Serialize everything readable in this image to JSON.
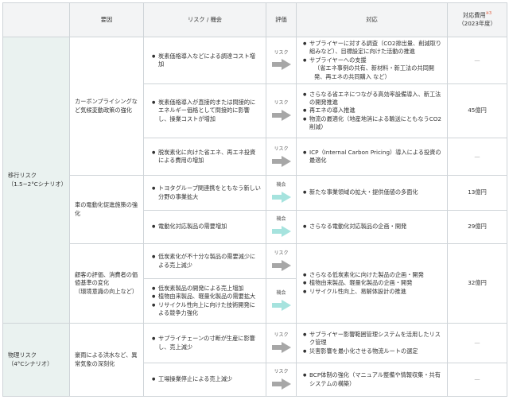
{
  "headers": {
    "factor": "要因",
    "risk": "リスク / 機会",
    "eval": "評価",
    "response": "対応",
    "cost_line1": "対応費用",
    "cost_note": "※3",
    "cost_line2": "（2023年度）"
  },
  "categories": {
    "transition": {
      "line1": "移行リスク",
      "line2": "（1.5~2°Cシナリオ）"
    },
    "physical": {
      "line1": "物理リスク",
      "line2": "（4°Cシナリオ）"
    }
  },
  "factors": {
    "carbon": "カーボンプライシングなど気候変動政策の強化",
    "ev": "車の電動化促進施策の強化",
    "customer_line1": "顧客の評価、消費者の価値基準の変化",
    "customer_line2": "（環境意識の向上など）",
    "weather": "豪雨による洪水など、異常気象の深刻化"
  },
  "eval_labels": {
    "risk": "リスク",
    "opportunity": "機会"
  },
  "colors": {
    "risk_arrow": "#a7a7a7",
    "opportunity_arrow": "#a6e3de",
    "category_bg": "#eaf2f0",
    "header_bg": "#f3f4f5"
  },
  "rows": [
    {
      "risk": [
        "炭素価格導入などによる調達コスト増加"
      ],
      "response": [
        "サプライヤーに対する調査（CO2排出量、削減取り組みなど）、目標設定に向けた活動の推進",
        "サプライヤーへの支援",
        "（省エネ事例の共有、新材料・新工法の共同開発、再エネの共同購入 など）"
      ],
      "cost": "—"
    },
    {
      "risk": [
        "炭素価格導入が直接的または間接的にエネルギー価格として間接的に影響し、操業コストが増加"
      ],
      "response": [
        "さらなる省エネにつながる高効率設備導入、新工法の開発推進",
        "再エネの導入推進",
        "物流の最適化（地産地消による輸送にともなうCO2削減）"
      ],
      "cost": "45億円"
    },
    {
      "risk": [
        "脱炭素化に向けた省エネ、再エネ投資による費用の増加"
      ],
      "response": [
        "ICP（Internal Carbon Pricing）導入による投資の最適化"
      ],
      "cost": "—"
    },
    {
      "risk": [
        "トヨタグループ関連携をともなう新しい分野の事業拡大"
      ],
      "response": [
        "新たな事業領域の拡大・提供価値の多面化"
      ],
      "cost": "13億円"
    },
    {
      "risk": [
        "電動化対応製品の需要増加"
      ],
      "response": [
        "さらなる電動化対応製品の企画・開発"
      ],
      "cost": "29億円"
    },
    {
      "risk": [
        "低炭素化が不十分な製品の需要減少による売上減少"
      ],
      "response": [
        "さらなる低炭素化に向けた製品の企画・開発",
        "植物由来製品、軽量化製品の企画・開発",
        "リサイクル性向上、易解体設計の推進"
      ],
      "cost": "32億円"
    },
    {
      "risk": [
        "低炭素製品の開発による売上増加",
        "植物由来製品、軽量化製品の需要拡大",
        "リサイクル性向上に向けた技術開発による競争力強化"
      ]
    },
    {
      "risk": [
        "サプライチェーンの寸断が生産に影響し、売上減少"
      ],
      "response": [
        "サプライヤー影響範囲管理システムを活用したリスク管理",
        "災害影響を最小化させる物流ルートの選定"
      ],
      "cost": "—"
    },
    {
      "risk": [
        "工場操業停止による売上減少"
      ],
      "response": [
        "BCP体制の強化（マニュアル整備や情報収集・共有システムの構築）"
      ],
      "cost": "—"
    }
  ]
}
